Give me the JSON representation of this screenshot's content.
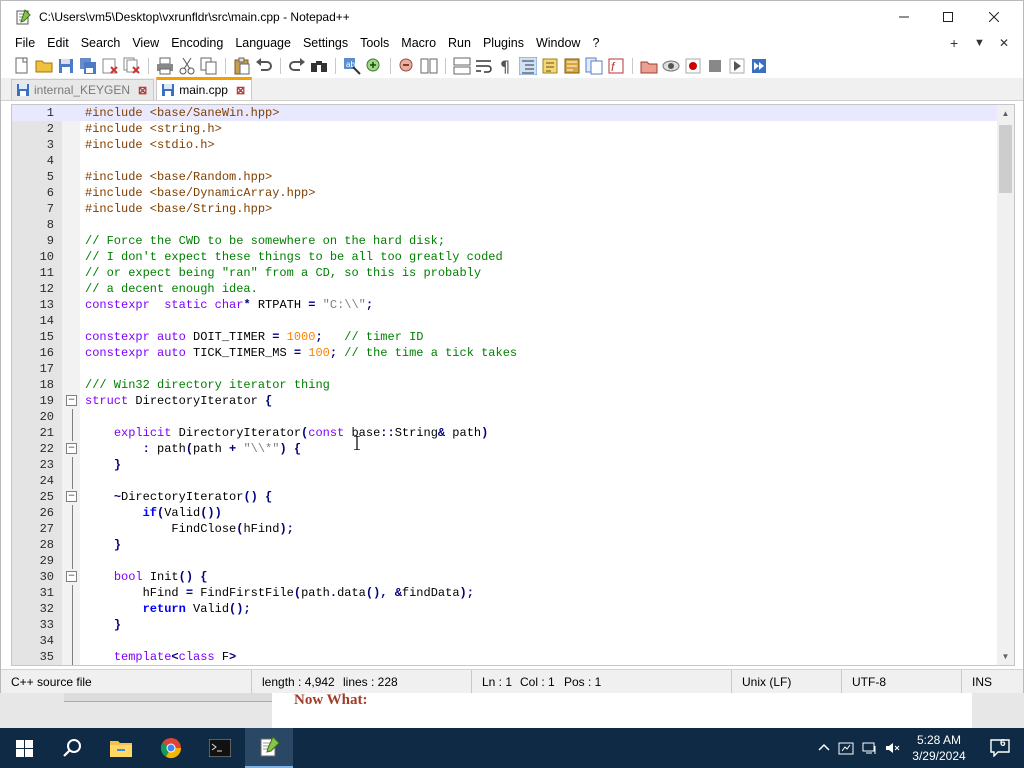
{
  "window": {
    "title": "C:\\Users\\vm5\\Desktop\\vxrunfldr\\src\\main.cpp - Notepad++"
  },
  "menu": [
    "File",
    "Edit",
    "Search",
    "View",
    "Encoding",
    "Language",
    "Settings",
    "Tools",
    "Macro",
    "Run",
    "Plugins",
    "Window",
    "?"
  ],
  "menu_right": {
    "add": "+",
    "dropdown": "▼",
    "close": "✕"
  },
  "toolbar_icons": [
    "new-file-icon",
    "open-file-icon",
    "save-icon",
    "save-all-icon",
    "close-icon",
    "close-all-icon",
    "print-icon",
    "cut-icon",
    "copy-icon",
    "paste-icon",
    "undo-icon",
    "redo-icon",
    "find-icon",
    "replace-icon",
    "zoom-in-icon",
    "zoom-out-icon",
    "sync-vertical-icon",
    "sync-horizontal-icon",
    "word-wrap-icon",
    "show-all-chars-icon",
    "indent-guide-icon",
    "udl-icon",
    "document-map-icon",
    "function-list-icon",
    "folder-workspace-icon",
    "monitoring-icon",
    "record-macro-icon",
    "stop-macro-icon",
    "play-macro-icon",
    "run-macro-multiple-icon",
    "save-macro-icon"
  ],
  "tabs": [
    {
      "label": "internal_KEYGEN",
      "active": false
    },
    {
      "label": "main.cpp",
      "active": true
    }
  ],
  "code": [
    {
      "n": "1",
      "fold": "",
      "tokens": [
        [
          "pp",
          "#include <base/SaneWin.hpp>"
        ]
      ]
    },
    {
      "n": "2",
      "fold": "",
      "tokens": [
        [
          "pp",
          "#include <string.h>"
        ]
      ]
    },
    {
      "n": "3",
      "fold": "",
      "tokens": [
        [
          "pp",
          "#include <stdio.h>"
        ]
      ]
    },
    {
      "n": "4",
      "fold": "",
      "tokens": []
    },
    {
      "n": "5",
      "fold": "",
      "tokens": [
        [
          "pp",
          "#include <base/Random.hpp>"
        ]
      ]
    },
    {
      "n": "6",
      "fold": "",
      "tokens": [
        [
          "pp",
          "#include <base/DynamicArray.hpp>"
        ]
      ]
    },
    {
      "n": "7",
      "fold": "",
      "tokens": [
        [
          "pp",
          "#include <base/String.hpp>"
        ]
      ]
    },
    {
      "n": "8",
      "fold": "",
      "tokens": []
    },
    {
      "n": "9",
      "fold": "",
      "tokens": [
        [
          "cm",
          "// Force the CWD to be somewhere on the hard disk;"
        ]
      ]
    },
    {
      "n": "10",
      "fold": "",
      "tokens": [
        [
          "cm",
          "// I don't expect these things to be all too greatly coded"
        ]
      ]
    },
    {
      "n": "11",
      "fold": "",
      "tokens": [
        [
          "cm",
          "// or expect being \"ran\" from a CD, so this is probably"
        ]
      ]
    },
    {
      "n": "12",
      "fold": "",
      "tokens": [
        [
          "cm",
          "// a decent enough idea."
        ]
      ]
    },
    {
      "n": "13",
      "fold": "",
      "tokens": [
        [
          "kw",
          "constexpr"
        ],
        [
          "",
          "  "
        ],
        [
          "kw",
          "static"
        ],
        [
          "",
          " "
        ],
        [
          "kw",
          "char"
        ],
        [
          "op",
          "*"
        ],
        [
          "",
          " RTPATH "
        ],
        [
          "op",
          "="
        ],
        [
          "",
          " "
        ],
        [
          "str",
          "\"C:\\\\\""
        ],
        [
          "op",
          ";"
        ]
      ]
    },
    {
      "n": "14",
      "fold": "",
      "tokens": []
    },
    {
      "n": "15",
      "fold": "",
      "tokens": [
        [
          "kw",
          "constexpr"
        ],
        [
          "",
          " "
        ],
        [
          "kw",
          "auto"
        ],
        [
          "",
          " DOIT_TIMER "
        ],
        [
          "op",
          "="
        ],
        [
          "",
          " "
        ],
        [
          "num",
          "1000"
        ],
        [
          "op",
          ";"
        ],
        [
          "",
          "   "
        ],
        [
          "cm",
          "// timer ID"
        ]
      ]
    },
    {
      "n": "16",
      "fold": "",
      "tokens": [
        [
          "kw",
          "constexpr"
        ],
        [
          "",
          " "
        ],
        [
          "kw",
          "auto"
        ],
        [
          "",
          " TICK_TIMER_MS "
        ],
        [
          "op",
          "="
        ],
        [
          "",
          " "
        ],
        [
          "num",
          "100"
        ],
        [
          "op",
          ";"
        ],
        [
          "",
          " "
        ],
        [
          "cm",
          "// the time a tick takes"
        ]
      ]
    },
    {
      "n": "17",
      "fold": "",
      "tokens": []
    },
    {
      "n": "18",
      "fold": "",
      "tokens": [
        [
          "cm",
          "/// Win32 directory iterator thing"
        ]
      ]
    },
    {
      "n": "19",
      "fold": "open",
      "tokens": [
        [
          "kw",
          "struct"
        ],
        [
          "",
          " DirectoryIterator "
        ],
        [
          "op",
          "{"
        ]
      ]
    },
    {
      "n": "20",
      "fold": "line",
      "tokens": []
    },
    {
      "n": "21",
      "fold": "line",
      "tokens": [
        [
          "",
          "    "
        ],
        [
          "kw",
          "explicit"
        ],
        [
          "",
          " DirectoryIterator"
        ],
        [
          "op",
          "("
        ],
        [
          "kw",
          "const"
        ],
        [
          "",
          " base"
        ],
        [
          "op",
          "::"
        ],
        [
          "",
          "String"
        ],
        [
          "op",
          "&"
        ],
        [
          "",
          " path"
        ],
        [
          "op",
          ")"
        ]
      ]
    },
    {
      "n": "22",
      "fold": "open",
      "tokens": [
        [
          "",
          "        "
        ],
        [
          "op",
          ":"
        ],
        [
          "",
          " path"
        ],
        [
          "op",
          "("
        ],
        [
          "",
          "path "
        ],
        [
          "op",
          "+"
        ],
        [
          "",
          " "
        ],
        [
          "str",
          "\"\\\\*\""
        ],
        [
          "op",
          ")"
        ],
        [
          "",
          " "
        ],
        [
          "op",
          "{"
        ]
      ]
    },
    {
      "n": "23",
      "fold": "line",
      "tokens": [
        [
          "",
          "    "
        ],
        [
          "op",
          "}"
        ]
      ]
    },
    {
      "n": "24",
      "fold": "line",
      "tokens": []
    },
    {
      "n": "25",
      "fold": "open",
      "tokens": [
        [
          "",
          "    "
        ],
        [
          "op",
          "~"
        ],
        [
          "",
          "DirectoryIterator"
        ],
        [
          "op",
          "()"
        ],
        [
          "",
          " "
        ],
        [
          "op",
          "{"
        ]
      ]
    },
    {
      "n": "26",
      "fold": "line",
      "tokens": [
        [
          "",
          "        "
        ],
        [
          "kb",
          "if"
        ],
        [
          "op",
          "("
        ],
        [
          "",
          "Valid"
        ],
        [
          "op",
          "())"
        ]
      ]
    },
    {
      "n": "27",
      "fold": "line",
      "tokens": [
        [
          "",
          "            FindClose"
        ],
        [
          "op",
          "("
        ],
        [
          "",
          "hFind"
        ],
        [
          "op",
          ");"
        ]
      ]
    },
    {
      "n": "28",
      "fold": "line",
      "tokens": [
        [
          "",
          "    "
        ],
        [
          "op",
          "}"
        ]
      ]
    },
    {
      "n": "29",
      "fold": "line",
      "tokens": []
    },
    {
      "n": "30",
      "fold": "open",
      "tokens": [
        [
          "",
          "    "
        ],
        [
          "kw",
          "bool"
        ],
        [
          "",
          " Init"
        ],
        [
          "op",
          "()"
        ],
        [
          "",
          " "
        ],
        [
          "op",
          "{"
        ]
      ]
    },
    {
      "n": "31",
      "fold": "line",
      "tokens": [
        [
          "",
          "        hFind "
        ],
        [
          "op",
          "="
        ],
        [
          "",
          " FindFirstFile"
        ],
        [
          "op",
          "("
        ],
        [
          "",
          "path"
        ],
        [
          "op",
          "."
        ],
        [
          "",
          "data"
        ],
        [
          "op",
          "(),"
        ],
        [
          "",
          " "
        ],
        [
          "op",
          "&"
        ],
        [
          "",
          "findData"
        ],
        [
          "op",
          ");"
        ]
      ]
    },
    {
      "n": "32",
      "fold": "line",
      "tokens": [
        [
          "",
          "        "
        ],
        [
          "kb",
          "return"
        ],
        [
          "",
          " Valid"
        ],
        [
          "op",
          "();"
        ]
      ]
    },
    {
      "n": "33",
      "fold": "line",
      "tokens": [
        [
          "",
          "    "
        ],
        [
          "op",
          "}"
        ]
      ]
    },
    {
      "n": "34",
      "fold": "line",
      "tokens": []
    },
    {
      "n": "35",
      "fold": "line",
      "tokens": [
        [
          "",
          "    "
        ],
        [
          "kw",
          "template"
        ],
        [
          "op",
          "<"
        ],
        [
          "kw",
          "class"
        ],
        [
          "",
          " F"
        ],
        [
          "op",
          ">"
        ]
      ]
    }
  ],
  "status": {
    "file_type": "C++ source file",
    "length": "length : 4,942",
    "lines": "lines : 228",
    "ln": "Ln : 1",
    "col": "Col : 1",
    "pos": "Pos : 1",
    "eol": "Unix (LF)",
    "encoding": "UTF-8",
    "mode": "INS"
  },
  "background_window": {
    "heading": "Now What:"
  },
  "taskbar": {
    "apps": [
      "start-icon",
      "search-icon",
      "file-explorer-icon",
      "chrome-icon",
      "terminal-icon",
      "notepadpp-icon"
    ],
    "time": "5:28 AM",
    "date": "3/29/2024",
    "notification_count": "6"
  },
  "colors": {
    "comment": "#008000",
    "keyword": "#8000ff",
    "preprocessor": "#804000",
    "number": "#ff8000",
    "string": "#808080",
    "current_line": "#e8e8ff",
    "active_tab_accent": "#f6a000",
    "taskbar": "#0e2a44"
  }
}
